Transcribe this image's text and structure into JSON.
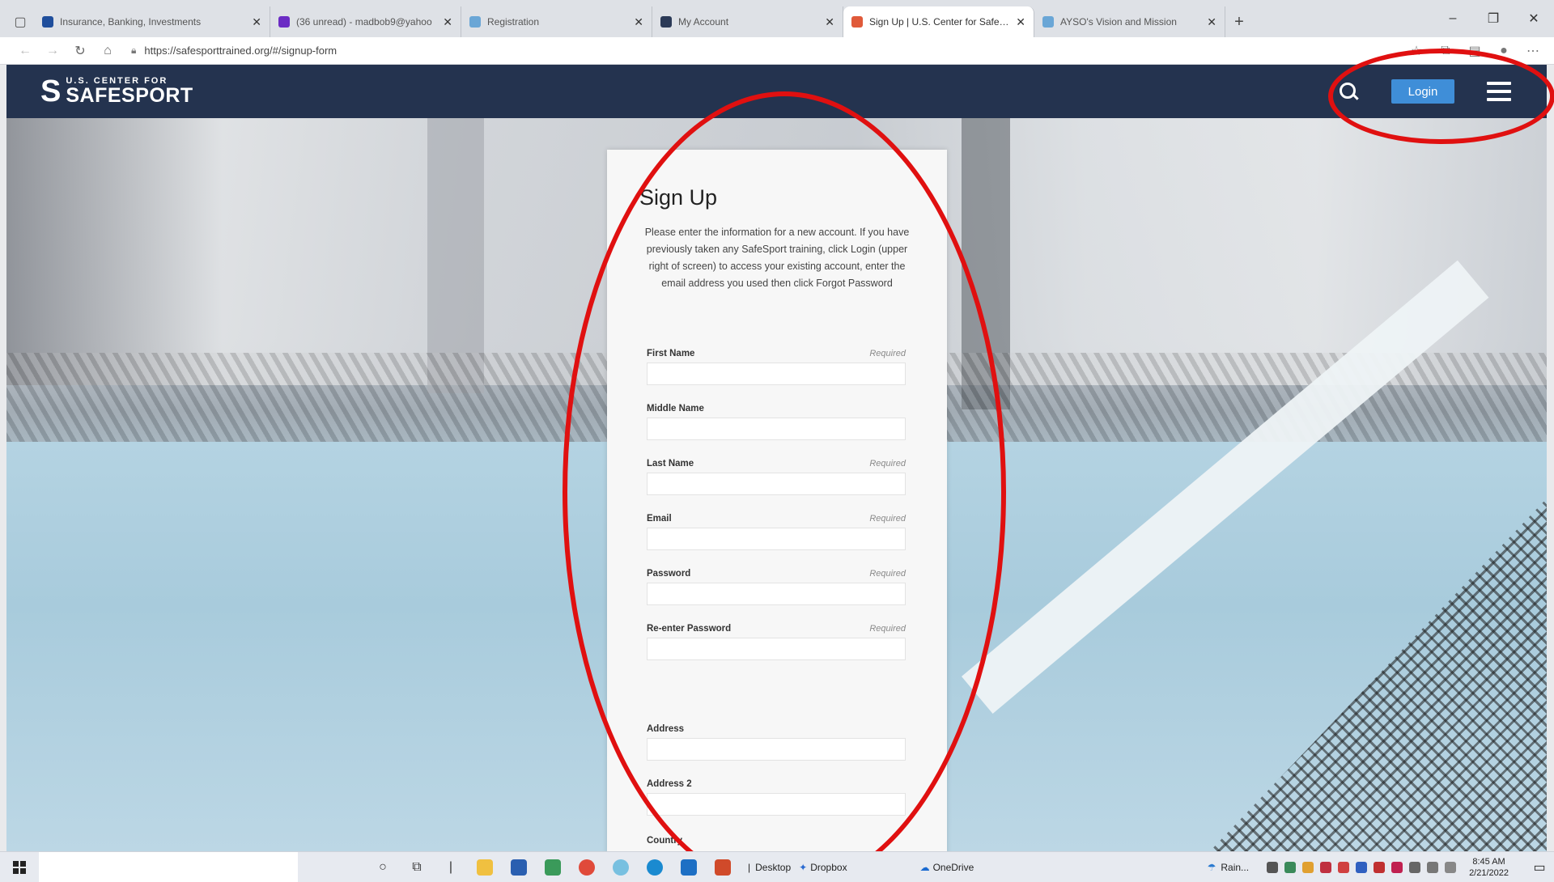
{
  "browser": {
    "tabs": [
      {
        "label": "Insurance, Banking, Investments",
        "favicon_color": "#1f4e9c",
        "active": false
      },
      {
        "label": "(36 unread) - madbob9@yahoo",
        "favicon_color": "#6b2cc4",
        "active": false
      },
      {
        "label": "Registration",
        "favicon_color": "#6aa6d6",
        "active": false
      },
      {
        "label": "My Account",
        "favicon_color": "#2b3a57",
        "active": false
      },
      {
        "label": "Sign Up | U.S. Center for SafeSp",
        "favicon_color": "#e05a3a",
        "active": true
      },
      {
        "label": "AYSO's Vision and Mission",
        "favicon_color": "#6aa6d6",
        "active": false
      }
    ],
    "url": "https://safesporttrained.org/#/signup-form"
  },
  "site": {
    "logo_small": "U.S. CENTER FOR",
    "logo_big": "SAFESPORT",
    "login_label": "Login",
    "header_color": "#24334f",
    "accent_color": "#3f8ed8"
  },
  "form": {
    "title": "Sign Up",
    "intro": "Please enter the information for a new account. If you have previously taken any SafeSport training, click Login (upper right of screen) to access your existing account, enter the email address you used then click Forgot Password",
    "required_text": "Required",
    "fields": [
      {
        "label": "First Name",
        "required": true,
        "value": ""
      },
      {
        "label": "Middle Name",
        "required": false,
        "value": ""
      },
      {
        "label": "Last Name",
        "required": true,
        "value": ""
      },
      {
        "label": "Email",
        "required": true,
        "value": ""
      },
      {
        "label": "Password",
        "required": true,
        "value": ""
      },
      {
        "label": "Re-enter Password",
        "required": true,
        "value": ""
      },
      {
        "label": "Address",
        "required": false,
        "value": ""
      },
      {
        "label": "Address 2",
        "required": false,
        "value": ""
      }
    ],
    "country_label": "Country"
  },
  "annotations": {
    "color": "#e01010",
    "shape": "ellipse"
  },
  "taskbar": {
    "desktop_label": "Desktop",
    "dropbox_label": "Dropbox",
    "onedrive_label": "OneDrive",
    "weather_label": "Rain...",
    "time": "8:45 AM",
    "date": "2/21/2022"
  }
}
